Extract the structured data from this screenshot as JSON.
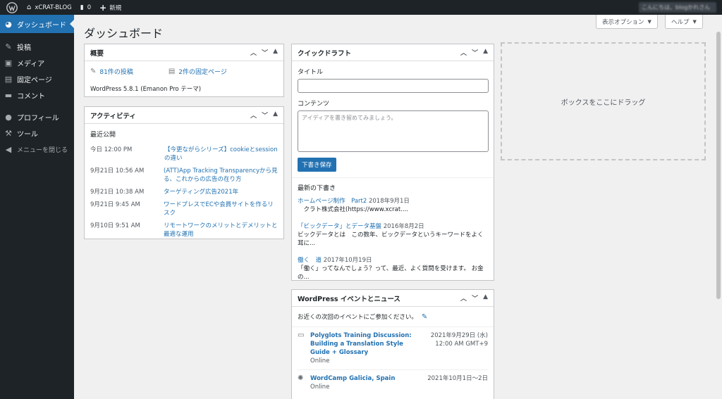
{
  "adminbar": {
    "site_name": "xCRAT-BLOG",
    "comments_count": "0",
    "new_label": "新規",
    "account_text": "こんにちは、blogかれさん"
  },
  "sidebar": {
    "items": [
      {
        "label": "ダッシュボード",
        "icon": "dashboard-icon"
      },
      {
        "label": "投稿",
        "icon": "pin-icon"
      },
      {
        "label": "メディア",
        "icon": "media-icon"
      },
      {
        "label": "固定ページ",
        "icon": "page-icon"
      },
      {
        "label": "コメント",
        "icon": "comment-icon"
      },
      {
        "label": "プロフィール",
        "icon": "user-icon"
      },
      {
        "label": "ツール",
        "icon": "wrench-icon"
      },
      {
        "label": "メニューを閉じる",
        "icon": "collapse-icon"
      }
    ]
  },
  "header": {
    "title": "ダッシュボード",
    "screen_options": "表示オプション",
    "help": "ヘルプ"
  },
  "glance": {
    "title": "概要",
    "posts": "81件の投稿",
    "pages": "2件の固定ページ",
    "version": "WordPress 5.8.1 (Emanon Pro テーマ)"
  },
  "activity": {
    "title": "アクティビティ",
    "recent": "最近公開",
    "rows": [
      {
        "date": "今日 12:00 PM",
        "title": "【今更ながらシリーズ】cookieとsessionの違い"
      },
      {
        "date": "9月21日 10:56 AM",
        "title": "(ATT)App Tracking Transparencyから見る、これからの広告の在り方"
      },
      {
        "date": "9月21日 10:38 AM",
        "title": "ターゲティング広告2021年"
      },
      {
        "date": "9月21日 9:45 AM",
        "title": "ワードプレスでECや会員サイトを作るリスク"
      },
      {
        "date": "9月10日 9:51 AM",
        "title": "リモートワークのメリットとデメリットと最適な運用"
      }
    ]
  },
  "quickdraft": {
    "title": "クイックドラフト",
    "title_label": "タイトル",
    "content_label": "コンテンツ",
    "content_placeholder": "アイディアを書き留めてみましょう。",
    "save": "下書き保存",
    "drafts_title": "最新の下書き",
    "drafts": [
      {
        "title": "ホームページ制作　Part2",
        "date": "2018年9月1日",
        "excerpt": "　クラト株式会社(https://www.xcrat...."
      },
      {
        "title": "「ビックデータ」とデータ基盤",
        "date": "2016年8月2日",
        "excerpt": "ビックデータとは　この数年、ビックデータというキーワードをよく耳に..."
      },
      {
        "title": "働く　道",
        "date": "2017年10月19日",
        "excerpt": "「働く」ってなんでしょう？って、最近、よく質問を受けます。 お金の..."
      }
    ]
  },
  "events": {
    "title": "WordPress イベントとニュース",
    "intro": "お近くの次回のイベントにご参加ください。",
    "items": [
      {
        "title": "Polyglots Training Discussion: Building a Translation Style Guide + Glossary",
        "sub": "Online",
        "date": "2021年9月29日 (水)",
        "time": "12:00 AM GMT+9",
        "icon": "meetup-icon"
      },
      {
        "title": "WordCamp Galicia, Spain",
        "sub": "Online",
        "date": "2021年10月1日～2日",
        "time": "",
        "icon": "wordcamp-icon"
      }
    ]
  },
  "dropzone": {
    "label": "ボックスをここにドラッグ"
  },
  "colors": {
    "adminbar": "#1d2327",
    "accent": "#2271b1",
    "background": "#f0f0f1"
  }
}
